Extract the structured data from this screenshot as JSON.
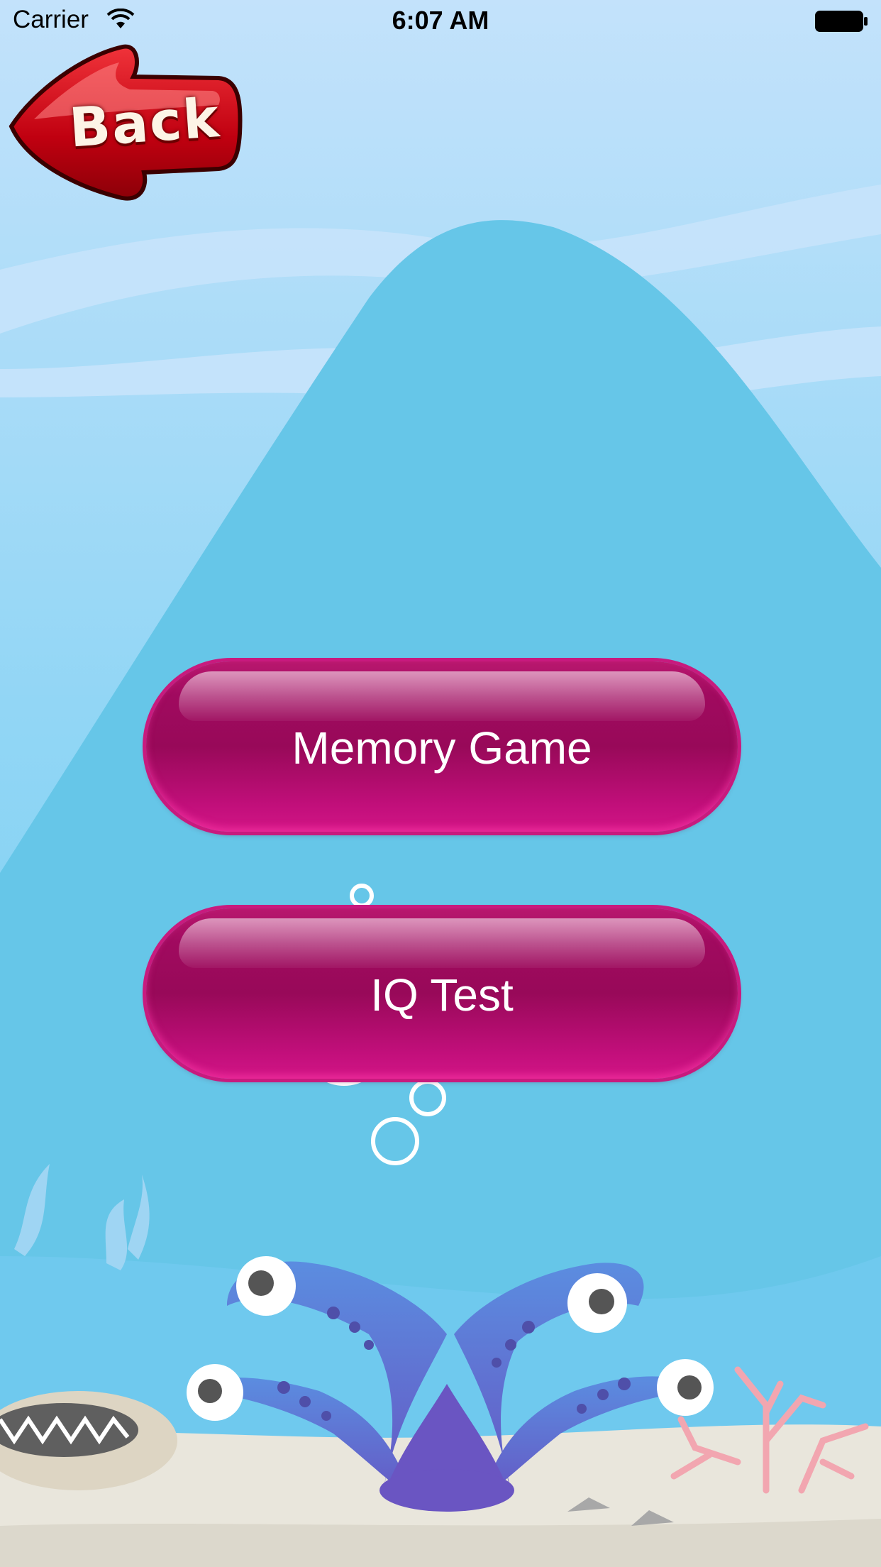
{
  "status_bar": {
    "carrier": "Carrier",
    "time": "6:07 AM"
  },
  "back_button": {
    "label": "Back"
  },
  "menu": {
    "buttons": [
      {
        "label": "Memory Game"
      },
      {
        "label": "IQ Test"
      }
    ]
  },
  "colors": {
    "sky_top": "#bfe0fb",
    "sky_mid": "#7dd0f2",
    "mountain": "#66c6e8",
    "button_magenta": "#a00a5f",
    "back_red": "#c80010",
    "sand": "#eae6da"
  },
  "icons": [
    "wifi-icon",
    "battery-icon",
    "back-arrow-icon",
    "octopus-icon",
    "shell-icon",
    "coral-icon",
    "bubble-icon",
    "seaweed-icon"
  ]
}
